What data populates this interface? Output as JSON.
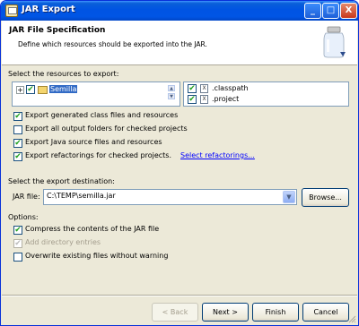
{
  "window": {
    "title": "JAR Export"
  },
  "title_buttons": {
    "minimize": "_",
    "maximize": "□",
    "close": "X"
  },
  "header": {
    "title": "JAR File Specification",
    "description": "Define which resources should be exported into the JAR."
  },
  "resources": {
    "label": "Select the resources to export:",
    "tree": {
      "expander": "+",
      "project": "Semilla",
      "checked": true
    },
    "files": [
      {
        "name": ".classpath",
        "checked": true,
        "icon": "x-file-icon"
      },
      {
        "name": ".project",
        "checked": true,
        "icon": "x-file-icon"
      }
    ]
  },
  "export_options": [
    {
      "label": "Export generated class files and resources",
      "checked": true
    },
    {
      "label": "Export all output folders for checked projects",
      "checked": false
    },
    {
      "label": "Export Java source files and resources",
      "checked": true
    },
    {
      "label": "Export refactorings for checked projects.",
      "checked": true
    }
  ],
  "select_refactorings_link": "Select refactorings...",
  "destination": {
    "label": "Select the export destination:",
    "jar_file_label": "JAR file:",
    "jar_file_value": "C:\\TEMP\\semilla.jar",
    "browse_label": "Browse..."
  },
  "options": {
    "label": "Options:",
    "items": [
      {
        "label": "Compress the contents of the JAR file",
        "checked": true,
        "enabled": true
      },
      {
        "label": "Add directory entries",
        "checked": true,
        "enabled": false
      },
      {
        "label": "Overwrite existing files without warning",
        "checked": false,
        "enabled": true
      }
    ]
  },
  "buttons": {
    "back": "< Back",
    "next": "Next >",
    "finish": "Finish",
    "cancel": "Cancel"
  },
  "check_glyph": "✔"
}
